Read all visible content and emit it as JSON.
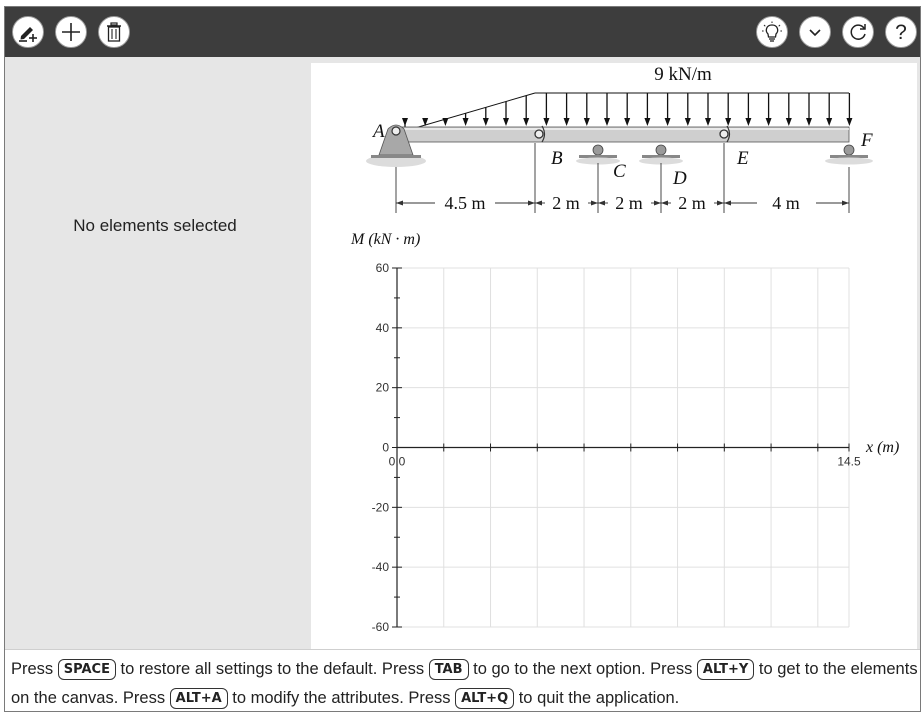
{
  "toolbar": {
    "left_buttons": [
      {
        "name": "edit-pen-button",
        "icon": "pen-add-icon"
      },
      {
        "name": "add-button",
        "icon": "plus-icon"
      },
      {
        "name": "delete-button",
        "icon": "trash-icon"
      }
    ],
    "right_buttons": [
      {
        "name": "hint-button",
        "icon": "lightbulb-icon"
      },
      {
        "name": "expand-button",
        "icon": "chevron-down-icon"
      },
      {
        "name": "reset-button",
        "icon": "redo-icon"
      },
      {
        "name": "help-button",
        "icon": "question-icon"
      },
      {
        "label": "?"
      }
    ]
  },
  "sidebar": {
    "message": "No elements selected"
  },
  "beam": {
    "load_label": "9 kN/m",
    "points": [
      "A",
      "B",
      "C",
      "D",
      "E",
      "F"
    ],
    "dimensions": [
      "4.5 m",
      "2 m",
      "2 m",
      "2 m",
      "4 m"
    ]
  },
  "chart_data": {
    "type": "line",
    "ylabel": "M (kN · m)",
    "xlabel": "x (m)",
    "xlim": [
      0,
      14.5
    ],
    "ylim": [
      -60,
      60
    ],
    "x_tick_labels": [
      "0.0",
      "14.5"
    ],
    "y_ticks": [
      60,
      40,
      20,
      0,
      -20,
      -40,
      -60
    ],
    "y_tick_labels": [
      "60",
      "40",
      "20",
      "0",
      "-20",
      "-40",
      "-60"
    ],
    "x_gridlines": [
      1.5,
      3,
      4.5,
      6,
      7.5,
      9,
      10.5,
      12,
      13.5
    ],
    "grid": true,
    "series": []
  },
  "footer": {
    "parts": [
      "Press ",
      "SPACE",
      " to restore all settings to the default. Press ",
      "TAB",
      " to go to the next option. Press ",
      "ALT+Y",
      " to get to the elements on the canvas. Press ",
      "ALT+A",
      " to modify the attributes. Press ",
      "ALT+Q",
      " to quit the application."
    ]
  }
}
